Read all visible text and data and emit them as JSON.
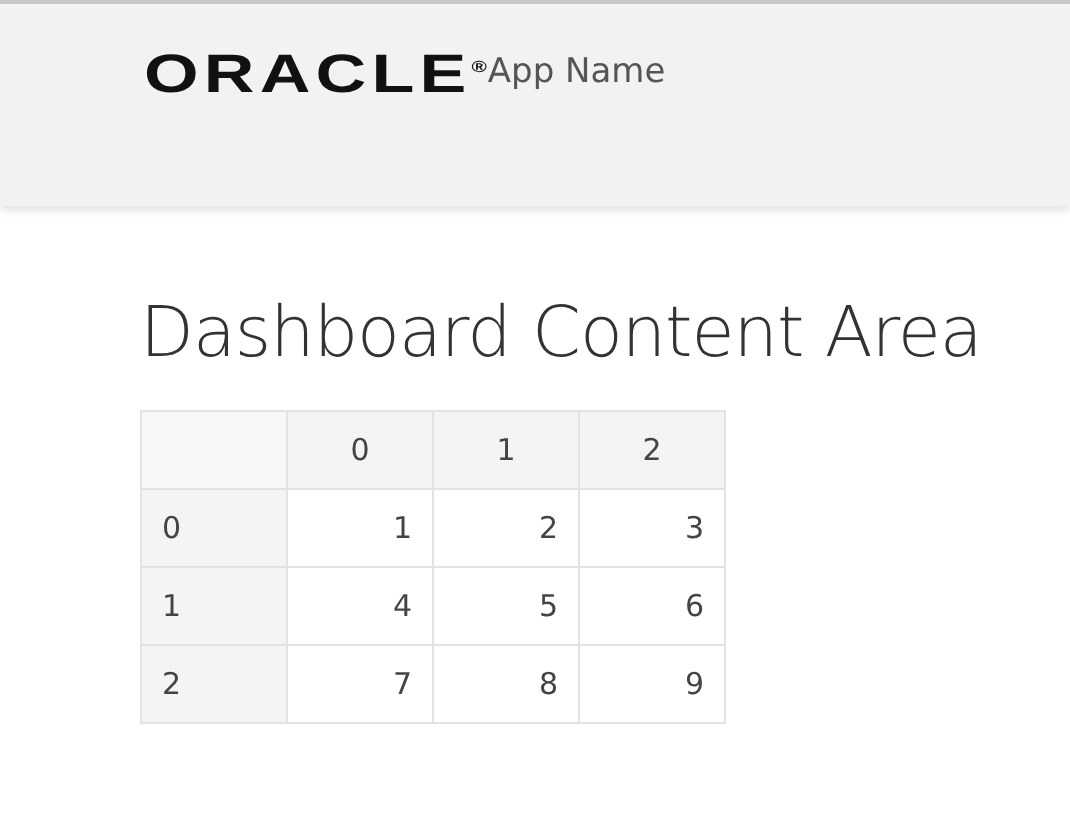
{
  "header": {
    "logo": "ORACLE$^{®}$",
    "app_name": "App Name"
  },
  "title": "Dashboard Content Area",
  "table": {
    "columns": [
      "0",
      "1",
      "2"
    ],
    "rows": [
      {
        "label": "0",
        "cells": [
          "1",
          "2",
          "3"
        ]
      },
      {
        "label": "1",
        "cells": [
          "4",
          "5",
          "6"
        ]
      },
      {
        "label": "2",
        "cells": [
          "7",
          "8",
          "9"
        ]
      }
    ]
  }
}
